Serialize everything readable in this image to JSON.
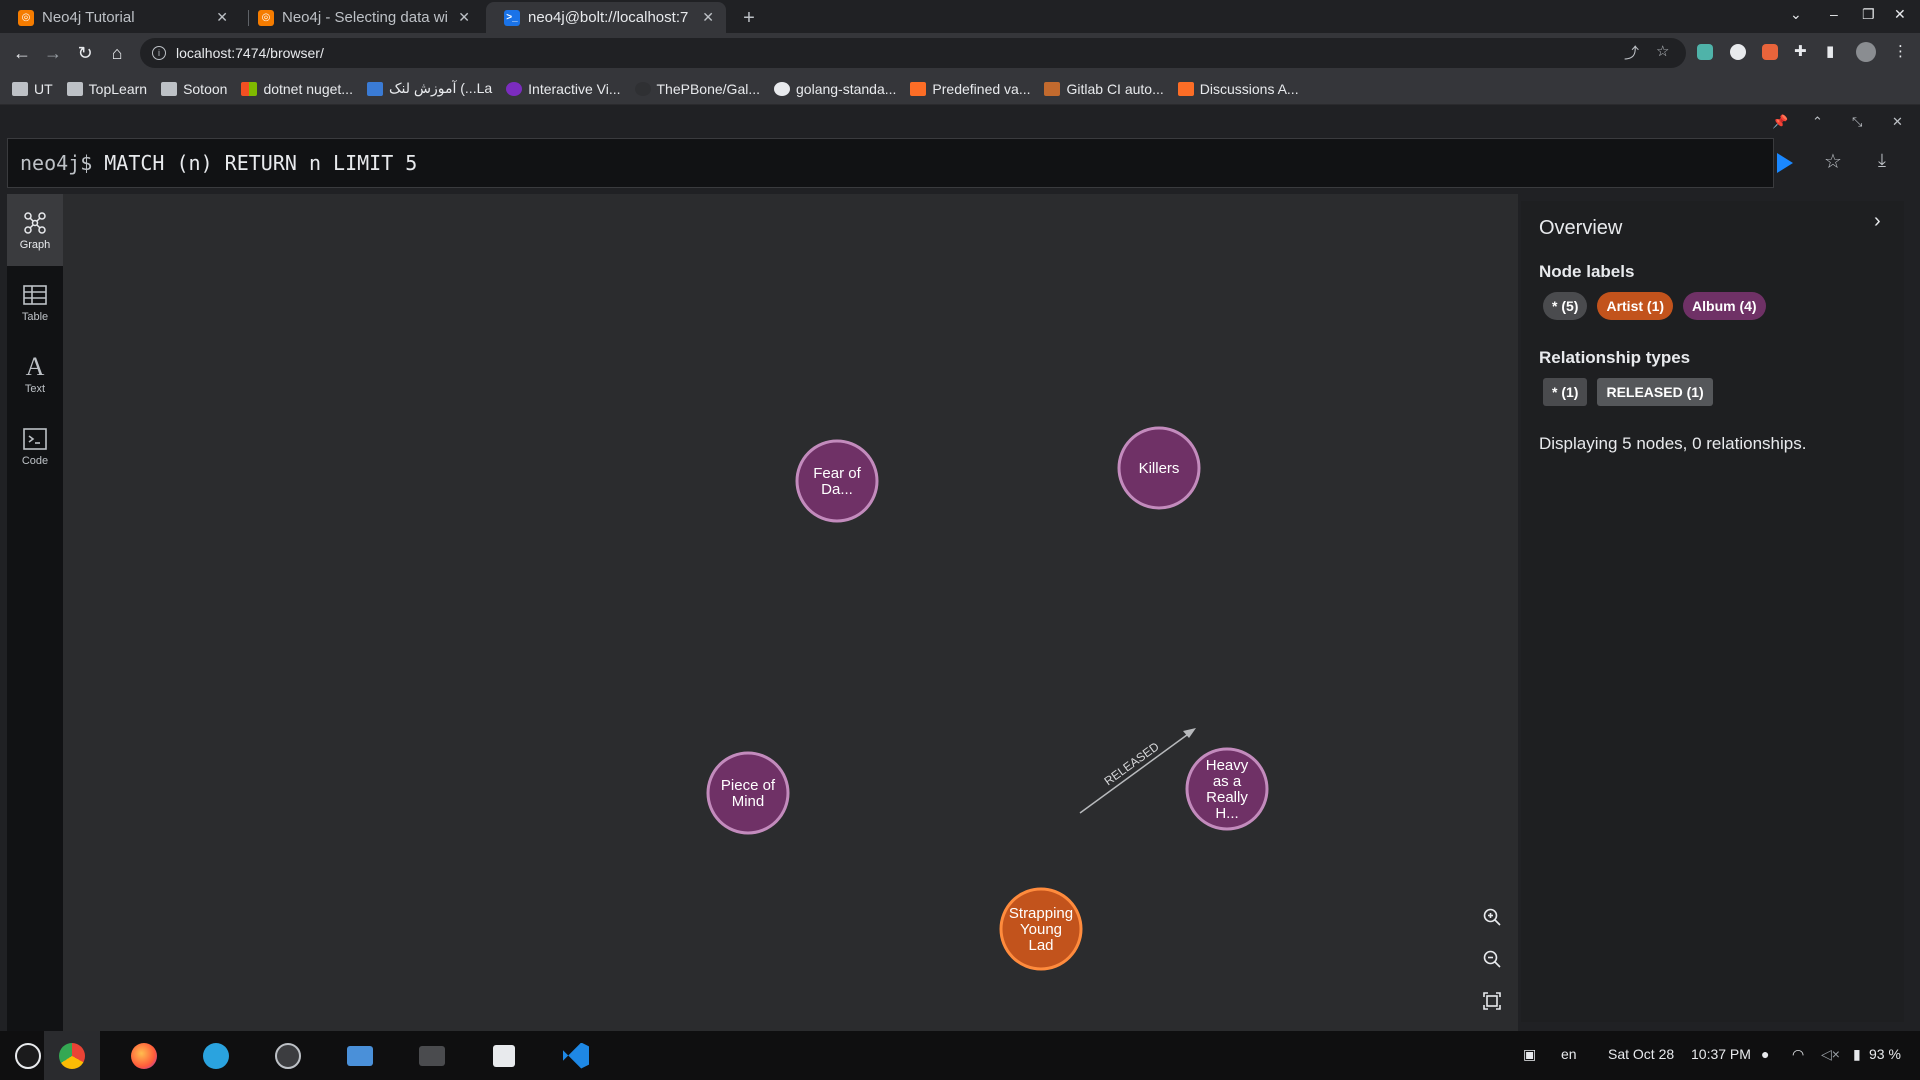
{
  "browser": {
    "tabs": [
      {
        "title": "Neo4j Tutorial",
        "favicon": "neo4j-orange-icon",
        "color": "#f57c00"
      },
      {
        "title": "Neo4j - Selecting data wi",
        "favicon": "neo4j-orange-icon",
        "color": "#f57c00"
      },
      {
        "title": "neo4j@bolt://localhost:7",
        "favicon": "terminal-blue-icon",
        "color": "#1a73e8"
      }
    ],
    "url": "localhost:7474/browser/",
    "bookmarks": [
      {
        "label": "UT",
        "icon": "folder-icon"
      },
      {
        "label": "TopLearn",
        "icon": "folder-icon"
      },
      {
        "label": "Sotoon",
        "icon": "folder-icon"
      },
      {
        "label": "dotnet nuget...",
        "icon": "microsoft-icon"
      },
      {
        "label": "آموزش لنک (...La",
        "icon": "site-icon"
      },
      {
        "label": "Interactive Vi...",
        "icon": "purple-site-icon"
      },
      {
        "label": "ThePBone/Gal...",
        "icon": "site-icon"
      },
      {
        "label": "golang-standa...",
        "icon": "github-icon"
      },
      {
        "label": "Predefined va...",
        "icon": "gitlab-icon"
      },
      {
        "label": "Gitlab CI auto...",
        "icon": "site-icon"
      },
      {
        "label": "Discussions A...",
        "icon": "gitlab-icon"
      }
    ]
  },
  "neo4j": {
    "prompt": "neo4j$",
    "query": "MATCH (n) RETURN n LIMIT 5",
    "views": [
      {
        "label": "Graph",
        "icon": "graph-icon"
      },
      {
        "label": "Table",
        "icon": "table-icon"
      },
      {
        "label": "Text",
        "icon": "text-icon"
      },
      {
        "label": "Code",
        "icon": "code-icon"
      }
    ],
    "active_view": "Graph",
    "graph": {
      "nodes": [
        {
          "lines": [
            "Fear of",
            "Da..."
          ],
          "label": "Album",
          "color": "#6f3166",
          "border": "#c38bbd"
        },
        {
          "lines": [
            "Killers"
          ],
          "label": "Album",
          "color": "#6f3166",
          "border": "#c38bbd"
        },
        {
          "lines": [
            "Piece of",
            "Mind"
          ],
          "label": "Album",
          "color": "#6f3166",
          "border": "#c38bbd"
        },
        {
          "lines": [
            "Heavy",
            "as a",
            "Really",
            "H..."
          ],
          "label": "Album",
          "color": "#6f3166",
          "border": "#c38bbd"
        },
        {
          "lines": [
            "Strapping",
            "Young",
            "Lad"
          ],
          "label": "Artist",
          "color": "#c2531c",
          "border": "#ff8b3d"
        }
      ],
      "relationship": {
        "type": "RELEASED"
      }
    },
    "overview": {
      "title": "Overview",
      "node_labels_heading": "Node labels",
      "node_labels": [
        {
          "text": "* (5)",
          "color": "#4a4b4e"
        },
        {
          "text": "Artist (1)",
          "color": "#c2531c"
        },
        {
          "text": "Album (4)",
          "color": "#6f3166"
        }
      ],
      "rel_types_heading": "Relationship types",
      "rel_types": [
        {
          "text": "* (1)",
          "color": "#4a4b4e"
        },
        {
          "text": "RELEASED (1)",
          "color": "#55575a"
        }
      ],
      "summary": "Displaying 5 nodes, 0 relationships."
    }
  },
  "taskbar": {
    "apps": [
      "owl-launcher-icon",
      "chrome-icon",
      "firefox-icon",
      "telegram-icon",
      "webstorm-icon",
      "files-icon",
      "terminal-icon",
      "settings-icon",
      "vscode-icon"
    ],
    "language": "en",
    "date": "Sat Oct 28",
    "time": "10:37 PM",
    "battery": "93 %"
  }
}
